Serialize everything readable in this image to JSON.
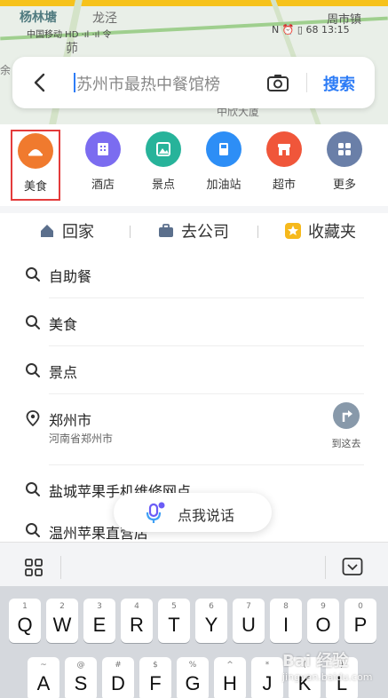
{
  "status_bar": {
    "left_text": "中国移动 HD ·ıl ·ıl 令",
    "right_text": "N ⏰ ▯ 68 13:15"
  },
  "map": {
    "places": [
      "杨林塘",
      "龙泾",
      "周市镇",
      "茆",
      "中欣大厦",
      "余"
    ]
  },
  "search": {
    "placeholder": "苏州市最热中餐馆榜",
    "button_label": "搜索"
  },
  "categories": [
    {
      "label": "美食",
      "icon": "food-icon",
      "color": "#f07a2e"
    },
    {
      "label": "酒店",
      "icon": "hotel-icon",
      "color": "#7b6cf0"
    },
    {
      "label": "景点",
      "icon": "scenic-icon",
      "color": "#27b39a"
    },
    {
      "label": "加油站",
      "icon": "gas-station-icon",
      "color": "#2d8ef6"
    },
    {
      "label": "超市",
      "icon": "supermarket-icon",
      "color": "#f0563a"
    },
    {
      "label": "更多",
      "icon": "more-icon",
      "color": "#6a7fa8"
    }
  ],
  "shortcuts": [
    {
      "label": "回家",
      "icon": "home-icon"
    },
    {
      "label": "去公司",
      "icon": "briefcase-icon"
    },
    {
      "label": "收藏夹",
      "icon": "star-icon"
    }
  ],
  "history": [
    {
      "text": "自助餐",
      "icon": "search-icon"
    },
    {
      "text": "美食",
      "icon": "search-icon"
    },
    {
      "text": "景点",
      "icon": "search-icon"
    },
    {
      "text": "郑州市",
      "sub": "河南省郑州市",
      "icon": "location-pin-icon"
    },
    {
      "text": "盐城苹果手机维修网点",
      "icon": "search-icon"
    },
    {
      "text": "温州苹果直营店",
      "icon": "search-icon"
    }
  ],
  "goto_label": "到这去",
  "voice_label": "点我说话",
  "keyboard": {
    "row1": [
      {
        "sub": "1",
        "main": "Q"
      },
      {
        "sub": "2",
        "main": "W"
      },
      {
        "sub": "3",
        "main": "E"
      },
      {
        "sub": "4",
        "main": "R"
      },
      {
        "sub": "5",
        "main": "T"
      },
      {
        "sub": "6",
        "main": "Y"
      },
      {
        "sub": "7",
        "main": "U"
      },
      {
        "sub": "8",
        "main": "I"
      },
      {
        "sub": "9",
        "main": "O"
      },
      {
        "sub": "0",
        "main": "P"
      }
    ],
    "row2": [
      {
        "sub": "~",
        "main": "A"
      },
      {
        "sub": "@",
        "main": "S"
      },
      {
        "sub": "#",
        "main": "D"
      },
      {
        "sub": "$",
        "main": "F"
      },
      {
        "sub": "%",
        "main": "G"
      },
      {
        "sub": "^",
        "main": "H"
      },
      {
        "sub": "*",
        "main": "J"
      },
      {
        "sub": "(",
        "main": "K"
      },
      {
        "sub": ")",
        "main": "L"
      }
    ]
  },
  "watermark": {
    "line1": "Bai 经验",
    "line2": "jingyan.baidu.com"
  }
}
